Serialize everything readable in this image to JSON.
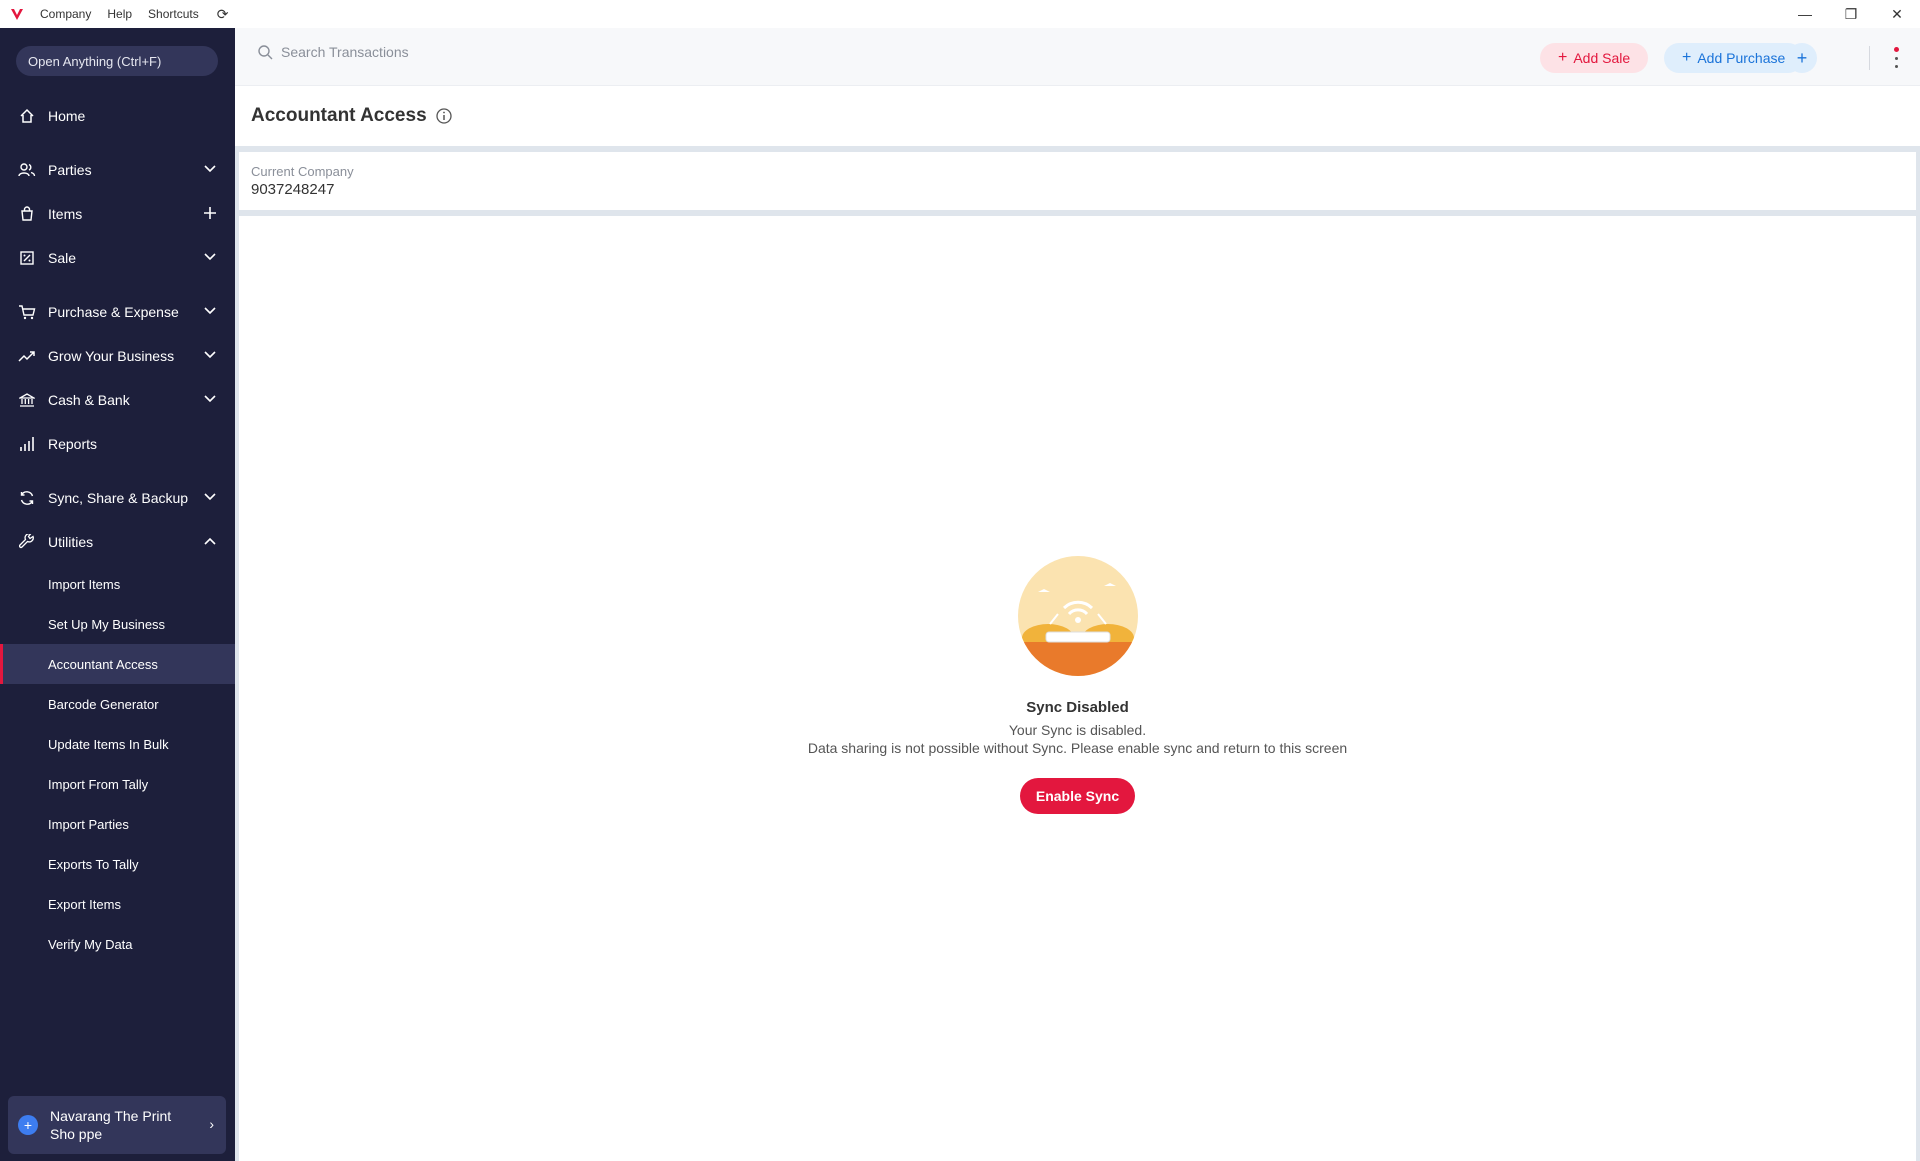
{
  "titlebar": {
    "menu": [
      "Company",
      "Help",
      "Shortcuts"
    ]
  },
  "sidebar": {
    "open_anything": "Open Anything (Ctrl+F)",
    "items": [
      {
        "label": "Home",
        "icon": "home-icon",
        "trail": ""
      },
      {
        "label": "Parties",
        "icon": "users-icon",
        "trail": "chevron-down"
      },
      {
        "label": "Items",
        "icon": "bag-icon",
        "trail": "plus"
      },
      {
        "label": "Sale",
        "icon": "sale-icon",
        "trail": "chevron-down"
      },
      {
        "label": "Purchase & Expense",
        "icon": "cart-icon",
        "trail": "chevron-down"
      },
      {
        "label": "Grow Your Business",
        "icon": "trend-icon",
        "trail": "chevron-down"
      },
      {
        "label": "Cash & Bank",
        "icon": "bank-icon",
        "trail": "chevron-down"
      },
      {
        "label": "Reports",
        "icon": "bar-chart-icon",
        "trail": ""
      },
      {
        "label": "Sync, Share & Backup",
        "icon": "sync-icon",
        "trail": "chevron-down"
      },
      {
        "label": "Utilities",
        "icon": "wrench-icon",
        "trail": "chevron-up"
      }
    ],
    "utilities_sub": [
      "Import Items",
      "Set Up My Business",
      "Accountant Access",
      "Barcode Generator",
      "Update Items In Bulk",
      "Import From Tally",
      "Import Parties",
      "Exports To Tally",
      "Export Items",
      "Verify My Data"
    ],
    "active_sub": "Accountant Access",
    "company_name": "Navarang The Print Sho ppe"
  },
  "topbar": {
    "search_placeholder": "Search Transactions",
    "add_sale": "Add Sale",
    "add_purchase": "Add Purchase"
  },
  "page": {
    "title": "Accountant Access",
    "current_company_label": "Current Company",
    "current_company_value": "9037248247",
    "empty_title": "Sync Disabled",
    "empty_line1": "Your Sync is disabled.",
    "empty_line2": "Data sharing is not possible without Sync. Please enable sync and return to this screen",
    "enable_button": "Enable Sync"
  },
  "colors": {
    "sidebar_bg": "#1d1f3b",
    "accent_red": "#e3173e",
    "accent_blue": "#1a73d9"
  }
}
